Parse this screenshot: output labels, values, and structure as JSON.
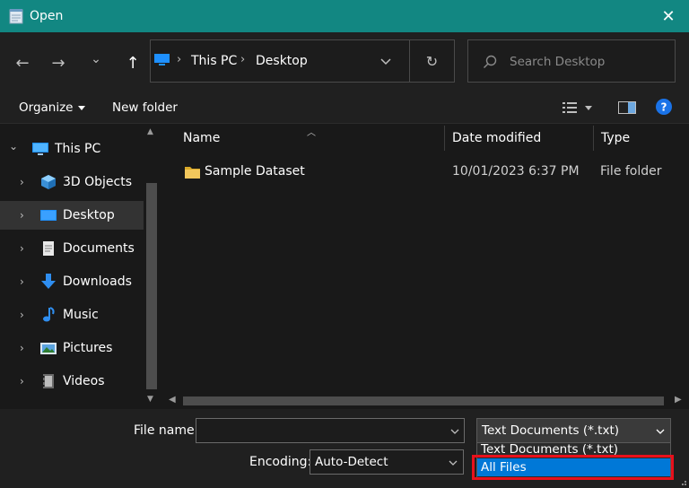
{
  "window": {
    "title": "Open",
    "close_glyph": "✕"
  },
  "nav": {
    "back_glyph": "←",
    "forward_glyph": "→",
    "recent_glyph": "⌄",
    "up_glyph": "↑",
    "refresh_glyph": "↻"
  },
  "address": {
    "crumbs": [
      "This PC",
      "Desktop"
    ],
    "separator": "›"
  },
  "search": {
    "placeholder": "Search Desktop"
  },
  "toolbar": {
    "organize_label": "Organize",
    "new_folder_label": "New folder"
  },
  "sidebar": {
    "items": [
      {
        "label": "This PC",
        "icon": "this-pc-icon",
        "expanded": true
      },
      {
        "label": "3D Objects",
        "icon": "3d-objects-icon"
      },
      {
        "label": "Desktop",
        "icon": "desktop-icon",
        "selected": true
      },
      {
        "label": "Documents",
        "icon": "documents-icon"
      },
      {
        "label": "Downloads",
        "icon": "downloads-icon"
      },
      {
        "label": "Music",
        "icon": "music-icon"
      },
      {
        "label": "Pictures",
        "icon": "pictures-icon"
      },
      {
        "label": "Videos",
        "icon": "videos-icon"
      }
    ],
    "expand_glyph": "›",
    "collapse_glyph": "⌄"
  },
  "file_list": {
    "columns": [
      "Name",
      "Date modified",
      "Type"
    ],
    "rows": [
      {
        "name": "Sample Dataset",
        "date_modified": "10/01/2023 6:37 PM",
        "type": "File folder"
      }
    ]
  },
  "footer": {
    "file_name_label": "File name:",
    "file_name_value": "",
    "file_type_selected": "Text Documents (*.txt)",
    "file_type_options": [
      "Text Documents (*.txt)",
      "All Files"
    ],
    "highlighted_option": "All Files",
    "encoding_label": "Encoding:",
    "encoding_value": "Auto-Detect"
  },
  "colors": {
    "titlebar": "#128782",
    "accent": "#0078d7",
    "highlight_frame": "#e8101b",
    "help": "#1a73e8",
    "folder": "#f2c75c"
  }
}
